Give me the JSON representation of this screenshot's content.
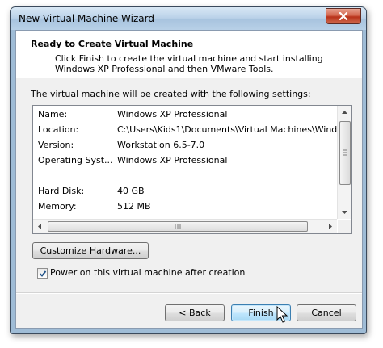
{
  "window": {
    "title": "New Virtual Machine Wizard",
    "close_icon": "close-icon"
  },
  "header": {
    "title": "Ready to Create Virtual Machine",
    "subtitle": "Click Finish to create the virtual machine and start installing Windows XP Professional and then VMware Tools."
  },
  "settings": {
    "intro": "The virtual machine will be created with the following settings:",
    "rows": [
      {
        "label": "Name:",
        "value": "Windows XP Professional"
      },
      {
        "label": "Location:",
        "value": "C:\\Users\\Kids1\\Documents\\Virtual Machines\\Wind..."
      },
      {
        "label": "Version:",
        "value": "Workstation 6.5-7.0"
      },
      {
        "label": "Operating Syst...",
        "value": "Windows XP Professional"
      },
      {
        "label": "",
        "value": ""
      },
      {
        "label": "Hard Disk:",
        "value": "40 GB"
      },
      {
        "label": "Memory:",
        "value": "512 MB"
      }
    ]
  },
  "buttons": {
    "customize": "Customize Hardware...",
    "back": "< Back",
    "finish": "Finish",
    "cancel": "Cancel"
  },
  "power_on": {
    "label": "Power on this virtual machine after creation",
    "checked": true
  }
}
